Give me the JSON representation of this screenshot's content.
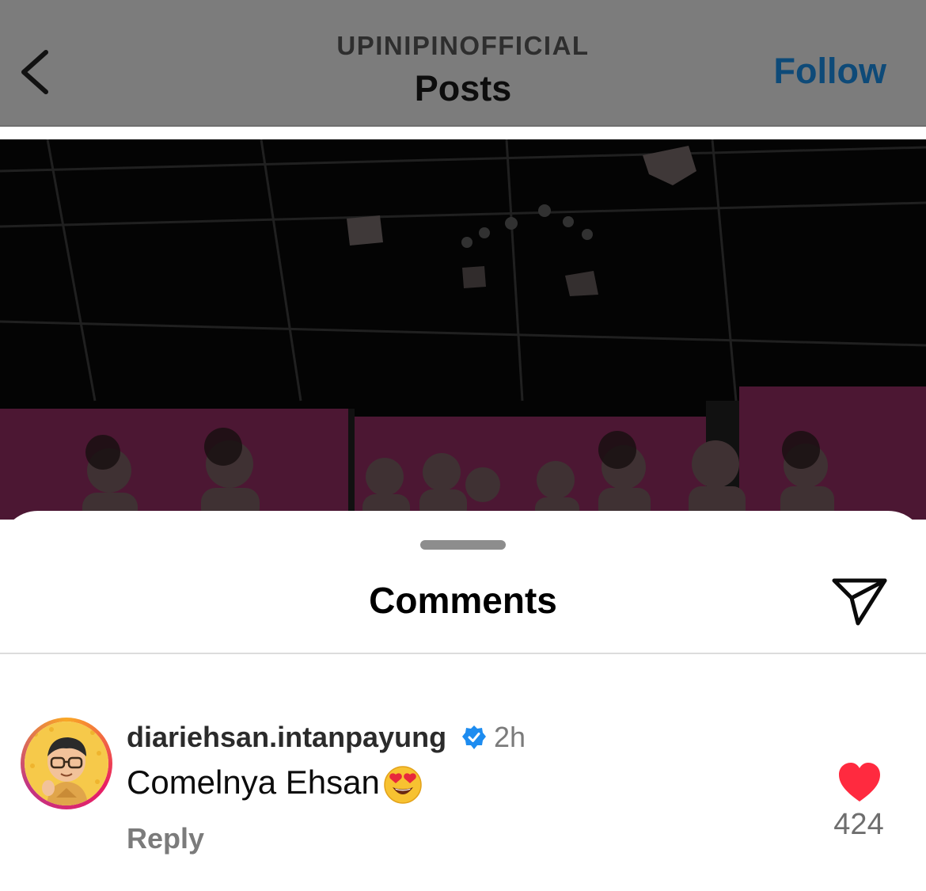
{
  "header": {
    "account": "UPINIPINOFFICIAL",
    "title": "Posts",
    "follow_label": "Follow"
  },
  "comments_sheet": {
    "title": "Comments"
  },
  "comment": {
    "username": "diariehsan.intanpayung",
    "timestamp": "2h",
    "text": "Comelnya Ehsan",
    "emoji": "smiling-face-with-heart-eyes",
    "reply_label": "Reply",
    "like_count": "424"
  },
  "colors": {
    "follow": "#0e4a78",
    "like": "#ff2a3f",
    "verified": "#1d8cf0",
    "banner": "#d62a86"
  },
  "icons": {
    "back": "chevron-left-icon",
    "share": "paper-plane-icon",
    "like": "heart-icon",
    "verified": "verified-badge-icon"
  }
}
